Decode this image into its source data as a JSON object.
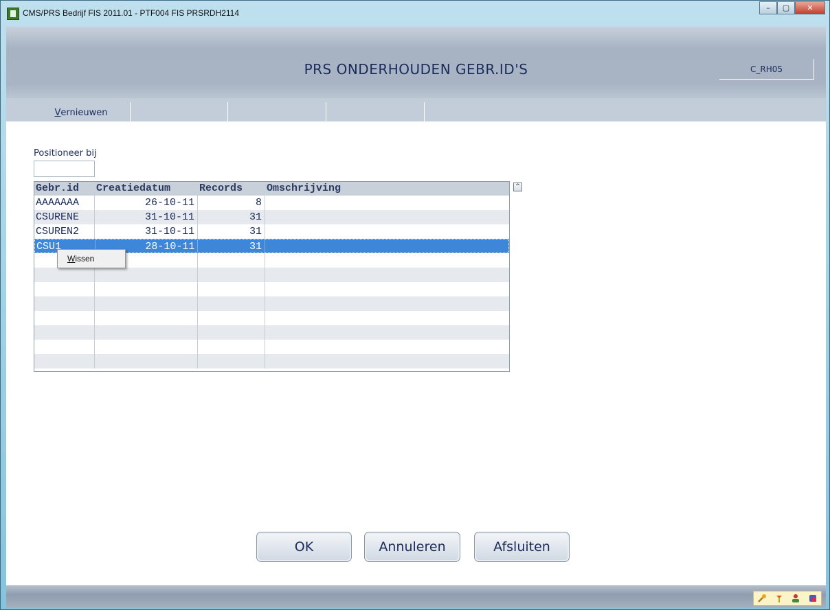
{
  "window": {
    "title": "CMS/PRS  Bedrijf FIS 2011.01  - PTF004 FIS PRSRDH2114",
    "minimize": "–",
    "maximize": "▢",
    "close": "✕"
  },
  "header": {
    "title": "PRS ONDERHOUDEN GEBR.ID'S",
    "code": "C_RH05"
  },
  "menubar": {
    "refresh_accel": "V",
    "refresh_rest": "ernieuwen"
  },
  "search": {
    "label": "Positioneer bij",
    "value": ""
  },
  "grid": {
    "columns": [
      "Gebr.id",
      "Creatiedatum",
      "Records",
      "Omschrijving"
    ],
    "rows": [
      {
        "id": "AAAAAAA",
        "date": "26-10-11",
        "records": "8",
        "desc": ""
      },
      {
        "id": "CSURENE",
        "date": "31-10-11",
        "records": "31",
        "desc": ""
      },
      {
        "id": "CSUREN2",
        "date": "31-10-11",
        "records": "31",
        "desc": ""
      },
      {
        "id": "CSU1",
        "date": "28-10-11",
        "records": "31",
        "desc": ""
      }
    ],
    "scroll_up": "^"
  },
  "context_menu": {
    "item_accel": "W",
    "item_rest": "issen"
  },
  "buttons": {
    "ok": "OK",
    "cancel": "Annuleren",
    "close": "Afsluiten"
  },
  "tray_icons": [
    "wrench-icon",
    "pointer-icon",
    "user-icon",
    "database-icon"
  ]
}
